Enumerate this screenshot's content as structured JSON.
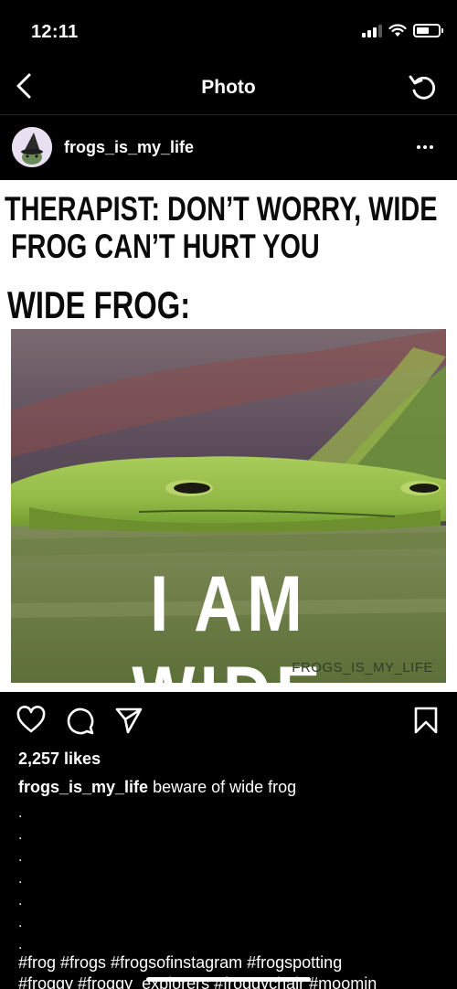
{
  "status": {
    "time": "12:11"
  },
  "nav": {
    "title": "Photo"
  },
  "post": {
    "username": "frogs_is_my_life",
    "meme": {
      "line1": "THERAPIST: DON’T WORRY, WIDE",
      "line2": "FROG CAN’T HURT YOU",
      "line3": "WIDE FROG:",
      "photo_caption": "I AM WIDE",
      "watermark": "FROGS_IS_MY_LIFE"
    },
    "likes": "2,257 likes",
    "caption_user": "frogs_is_my_life",
    "caption_text": "beware of wide frog",
    "dot_lines": [
      ".",
      ".",
      ".",
      ".",
      ".",
      ".",
      "."
    ],
    "hashtags_line1": "#frog #frogs #frogsofinstagram #frogspotting",
    "hashtags_line2": "#froggy #froggy_explorers #froggychair #moomin"
  },
  "icons": {
    "back": "chevron-left-icon",
    "refresh": "refresh-icon",
    "more": "more-horizontal-icon",
    "like": "heart-icon",
    "comment": "comment-icon",
    "share": "send-icon",
    "save": "bookmark-icon"
  }
}
